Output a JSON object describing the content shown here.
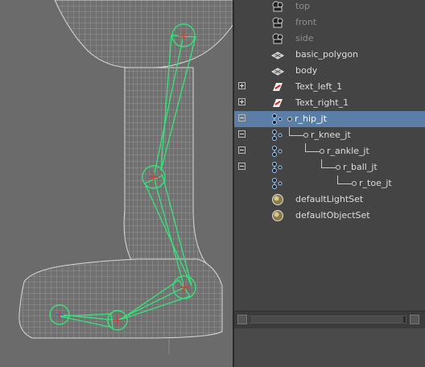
{
  "outliner": {
    "items": [
      {
        "label": "top",
        "icon": "camera-icon",
        "expander": "",
        "dim": true
      },
      {
        "label": "front",
        "icon": "camera-icon",
        "expander": "",
        "dim": true
      },
      {
        "label": "side",
        "icon": "camera-icon",
        "expander": "",
        "dim": true
      },
      {
        "label": "basic_polygon",
        "icon": "mesh-icon",
        "expander": "",
        "dim": false
      },
      {
        "label": "body",
        "icon": "mesh-icon",
        "expander": "",
        "dim": false
      },
      {
        "label": "Text_left_1",
        "icon": "text-curve-icon",
        "expander": "plus",
        "dim": false
      },
      {
        "label": "Text_right_1",
        "icon": "text-curve-icon",
        "expander": "plus",
        "dim": false
      },
      {
        "label": "r_hip_jt",
        "icon": "joint-icon",
        "expander": "minus",
        "dim": false,
        "selected": true
      },
      {
        "label": "r_knee_jt",
        "icon": "joint-icon",
        "expander": "minus",
        "dim": false
      },
      {
        "label": "r_ankle_jt",
        "icon": "joint-icon",
        "expander": "minus",
        "dim": false
      },
      {
        "label": "r_ball_jt",
        "icon": "joint-icon",
        "expander": "minus",
        "dim": false
      },
      {
        "label": "r_toe_jt",
        "icon": "joint-icon",
        "expander": "",
        "dim": false
      },
      {
        "label": "defaultLightSet",
        "icon": "set-icon",
        "expander": "",
        "dim": false
      },
      {
        "label": "defaultObjectSet",
        "icon": "set-icon",
        "expander": "",
        "dim": false
      }
    ]
  },
  "colors": {
    "selection": "#5b7ea6",
    "joint": "#37e07a",
    "joint_center": "#d23c3c",
    "wireframe": "#d8d8d8"
  }
}
